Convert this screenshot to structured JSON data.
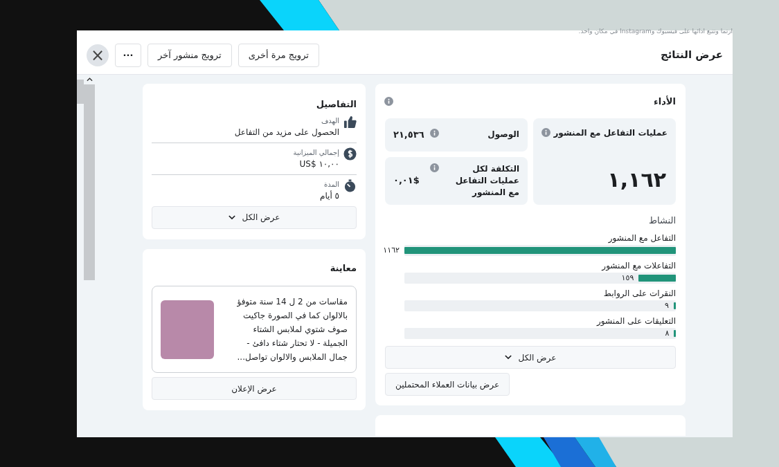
{
  "background_text": "ارتما وتتبع ادائها على فيسبوك وInstagram في مكان واحد.",
  "dialog": {
    "title": "عرض النتائج",
    "buttons": [
      "ترويج مرة أخرى",
      "ترويج منشور آخر"
    ],
    "more": "···",
    "close": "×"
  },
  "details": {
    "title": "التفاصيل",
    "items": [
      {
        "kind": "goal",
        "label": "الهدف",
        "value": "الحصول على مزيد من التفاعل"
      },
      {
        "kind": "budget",
        "label": "إجمالي الميزانية",
        "value": "١٠,٠٠ $US"
      },
      {
        "kind": "duration",
        "label": "المدة",
        "value": "٥ أيام"
      }
    ],
    "show_all": "عرض الكل"
  },
  "preview": {
    "title": "معاينة",
    "ad_text": "مقاسات من 2 ل 14 سنة متوفؤ بالالوان كما في الصورة جاكيت صوف شتوي لملابس الشتاء الجميلة - لا تحتار شتاء دافئ - جمال الملابس والالوان تواصل...",
    "button": "عرض الإعلان"
  },
  "performance": {
    "title": "الأداء",
    "main_metric": {
      "label": "عمليات التفاعل مع المنشور",
      "value": "١,١٦٢"
    },
    "metrics": [
      {
        "label": "الوصول",
        "value": "٢١,٥٣٦"
      },
      {
        "label": "التكلفة لكل عمليات التفاعل مع المنشور",
        "value": "$٠,٠١"
      }
    ],
    "activity_title": "النشاط",
    "activity": [
      {
        "label": "التفاعل مع المنشور",
        "value": "١١٦٢",
        "level": 1.0
      },
      {
        "label": "التفاعلات مع المنشور",
        "value": "١٥٩",
        "level": 0.137
      },
      {
        "label": "النقرات على الروابط",
        "value": "٩",
        "level": 0.0077
      },
      {
        "label": "التعليقات على المنشور",
        "value": "٨",
        "level": 0.0069
      }
    ],
    "show_all": "عرض الكل",
    "leads_button": "عرض بيانات العملاء المحتملين"
  }
}
